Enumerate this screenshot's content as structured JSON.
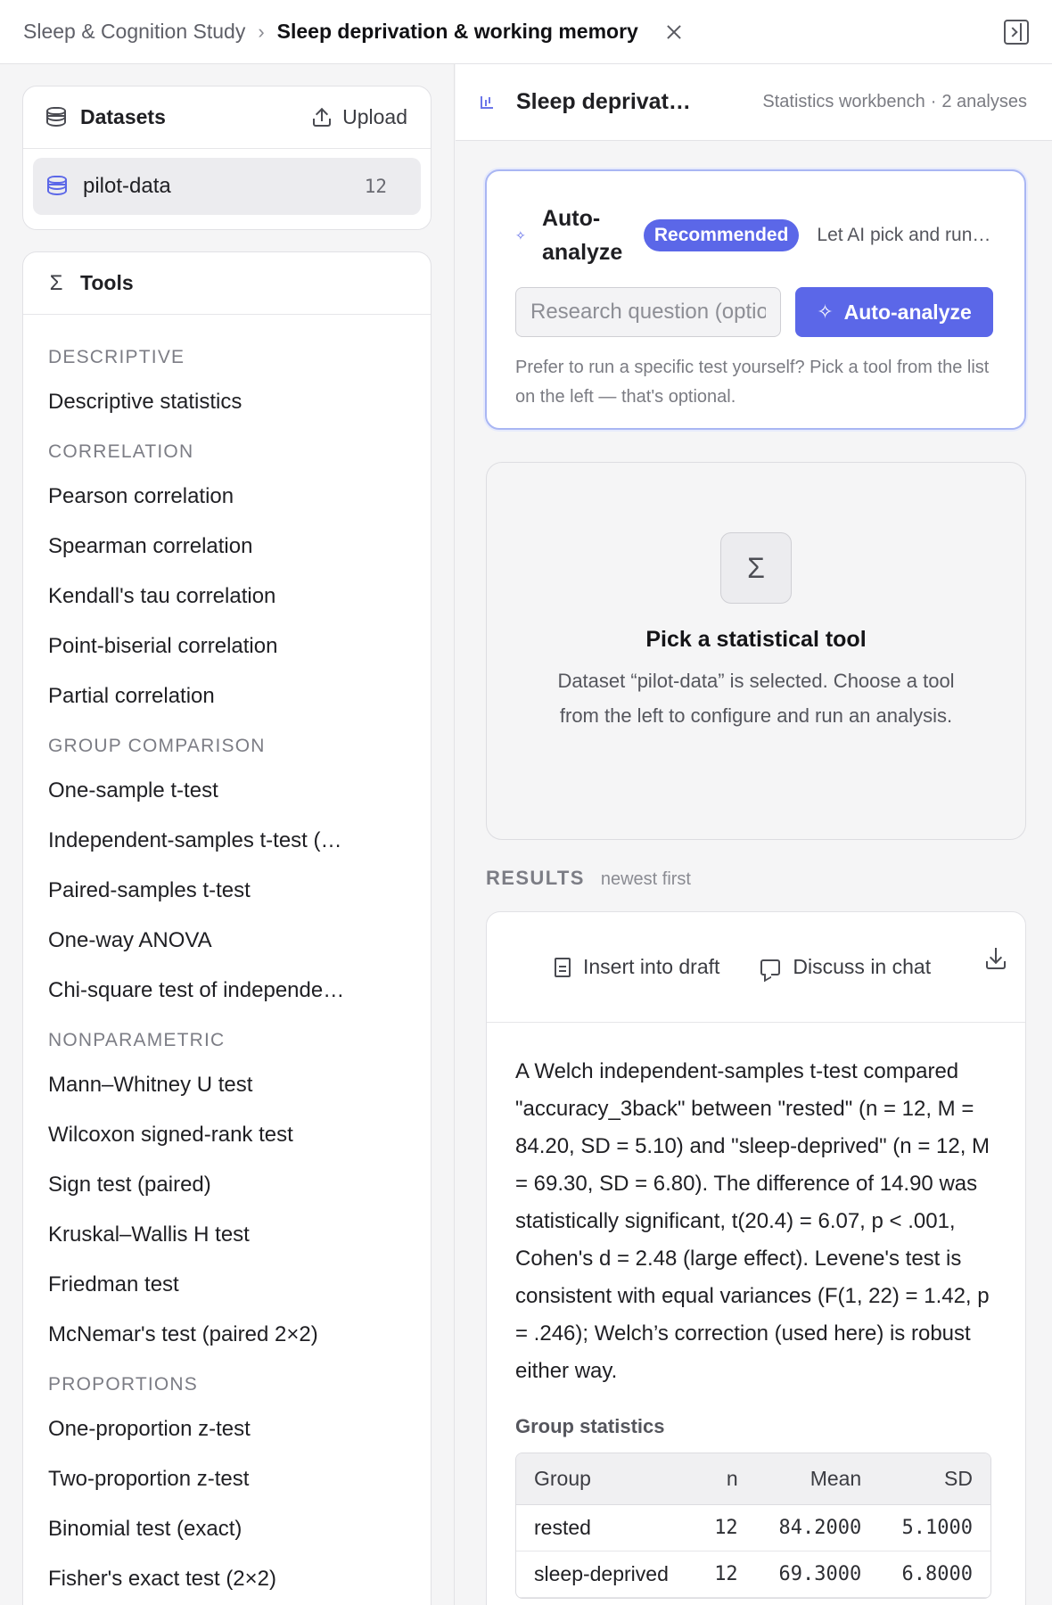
{
  "header": {
    "breadcrumb_parent": "Sleep & Cognition Study",
    "breadcrumb_current": "Sleep deprivation & working memory"
  },
  "sidebar": {
    "datasets": {
      "title": "Datasets",
      "upload_label": "Upload",
      "items": [
        {
          "name": "pilot-data",
          "count": "12"
        }
      ]
    },
    "tools": {
      "title": "Tools",
      "sections": [
        {
          "label": "DESCRIPTIVE",
          "items": [
            "Descriptive statistics"
          ]
        },
        {
          "label": "CORRELATION",
          "items": [
            "Pearson correlation",
            "Spearman correlation",
            "Kendall's tau correlation",
            "Point-biserial correlation",
            "Partial correlation"
          ]
        },
        {
          "label": "GROUP COMPARISON",
          "items": [
            "One-sample t-test",
            "Independent-samples t-test (…",
            "Paired-samples t-test",
            "One-way ANOVA",
            "Chi-square test of independe…"
          ]
        },
        {
          "label": "NONPARAMETRIC",
          "items": [
            "Mann–Whitney U test",
            "Wilcoxon signed-rank test",
            "Sign test (paired)",
            "Kruskal–Wallis H test",
            "Friedman test",
            "McNemar's test (paired 2×2)"
          ]
        },
        {
          "label": "PROPORTIONS",
          "items": [
            "One-proportion z-test",
            "Two-proportion z-test",
            "Binomial test (exact)",
            "Fisher's exact test (2×2)"
          ]
        }
      ]
    }
  },
  "main": {
    "title": "Sleep deprivat…",
    "meta_workbench": "Statistics workbench",
    "meta_sep": "·",
    "meta_count": "2 analyses",
    "auto": {
      "title": "Auto-analyze",
      "badge": "Recommended",
      "description": "Let AI pick and run …",
      "input_placeholder": "Research question (optional)",
      "input_value": "",
      "button_label": "Auto-analyze",
      "hint": "Prefer to run a specific test yourself? Pick a tool from the list on the left — that's optional."
    },
    "pick": {
      "icon": "Σ",
      "title": "Pick a statistical tool",
      "description": "Dataset “pilot-data” is selected. Choose a tool from the left to configure and run an analysis."
    },
    "results": {
      "label": "RESULTS",
      "sublabel": "newest first",
      "card": {
        "insert_label": "Insert into draft",
        "discuss_label": "Discuss in chat",
        "summary": "A Welch independent-samples t-test compared \"accuracy_3back\" between \"rested\" (n = 12, M = 84.20, SD = 5.10) and \"sleep-deprived\" (n = 12, M = 69.30, SD = 6.80). The difference of 14.90 was statistically significant, t(20.4) = 6.07, p < .001, Cohen's d = 2.48 (large effect). Levene's test is consistent with equal variances (F(1, 22) = 1.42, p = .246); Welch’s correction (used here) is robust either way.",
        "group_stats_title": "Group statistics",
        "table": {
          "headers": [
            "Group",
            "n",
            "Mean",
            "SD"
          ],
          "rows": [
            [
              "rested",
              "12",
              "84.2000",
              "5.1000"
            ],
            [
              "sleep-deprived",
              "12",
              "69.3000",
              "6.8000"
            ]
          ]
        }
      }
    }
  },
  "colors": {
    "accent": "#5b67e8",
    "accent_border": "#a9b6f3"
  }
}
